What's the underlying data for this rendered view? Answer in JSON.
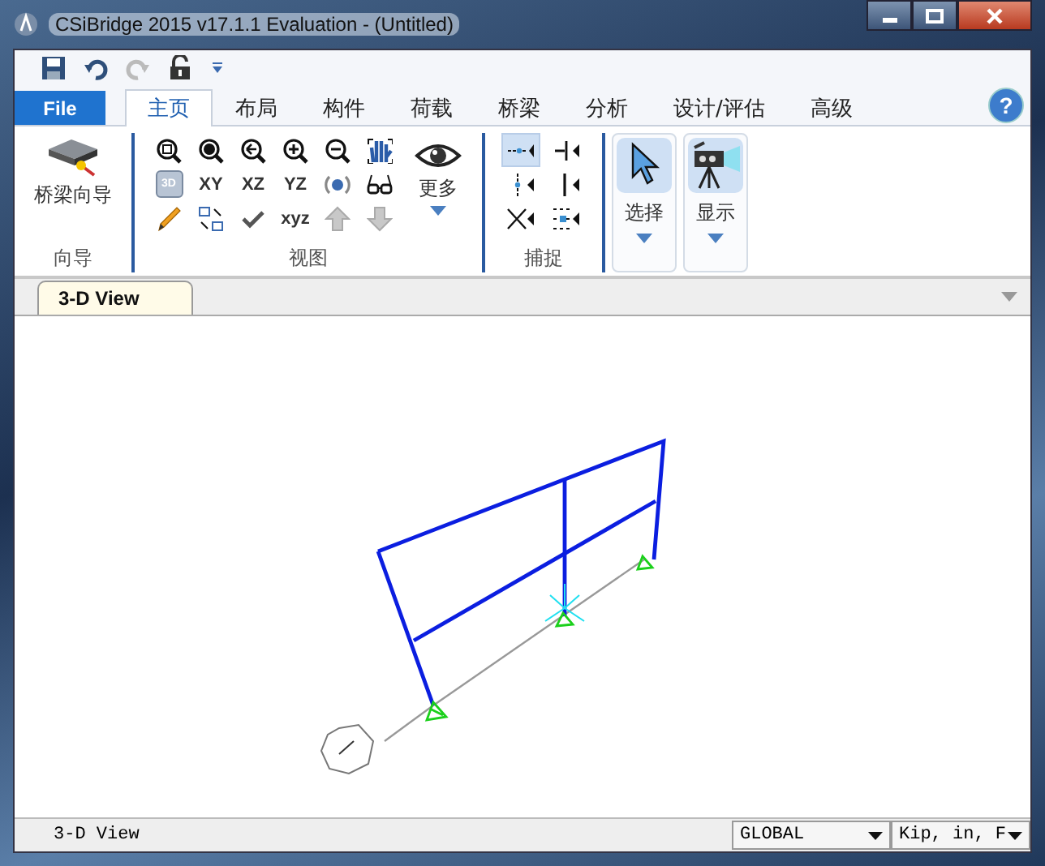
{
  "window": {
    "title": "CSiBridge 2015 v17.1.1 Evaluation  - (Untitled)"
  },
  "file_tab": {
    "label": "File"
  },
  "help": {
    "label": "?"
  },
  "tabs": [
    {
      "label": "主页",
      "selected": true
    },
    {
      "label": "布局",
      "selected": false
    },
    {
      "label": "构件",
      "selected": false
    },
    {
      "label": "荷载",
      "selected": false
    },
    {
      "label": "桥梁",
      "selected": false
    },
    {
      "label": "分析",
      "selected": false
    },
    {
      "label": "设计/评估",
      "selected": false
    },
    {
      "label": "高级",
      "selected": false
    }
  ],
  "ribbon": {
    "wizard": {
      "button": "桥梁向导",
      "group": "向导"
    },
    "view": {
      "group": "视图",
      "cube_label": "3D",
      "labels": [
        "XY",
        "XZ",
        "YZ",
        "xyz"
      ],
      "more": "更多"
    },
    "snap": {
      "group": "捕捉",
      "tools": [
        {
          "selected": true
        },
        {
          "selected": false
        },
        {
          "selected": false
        },
        {
          "selected": false
        },
        {
          "selected": false
        },
        {
          "selected": false
        }
      ]
    },
    "select": {
      "label": "选择"
    },
    "display": {
      "label": "显示"
    }
  },
  "document_tab": {
    "label": "3-D View"
  },
  "status_bar": {
    "view": "3-D View",
    "coord_system": "GLOBAL",
    "units": "Kip, in, F"
  }
}
